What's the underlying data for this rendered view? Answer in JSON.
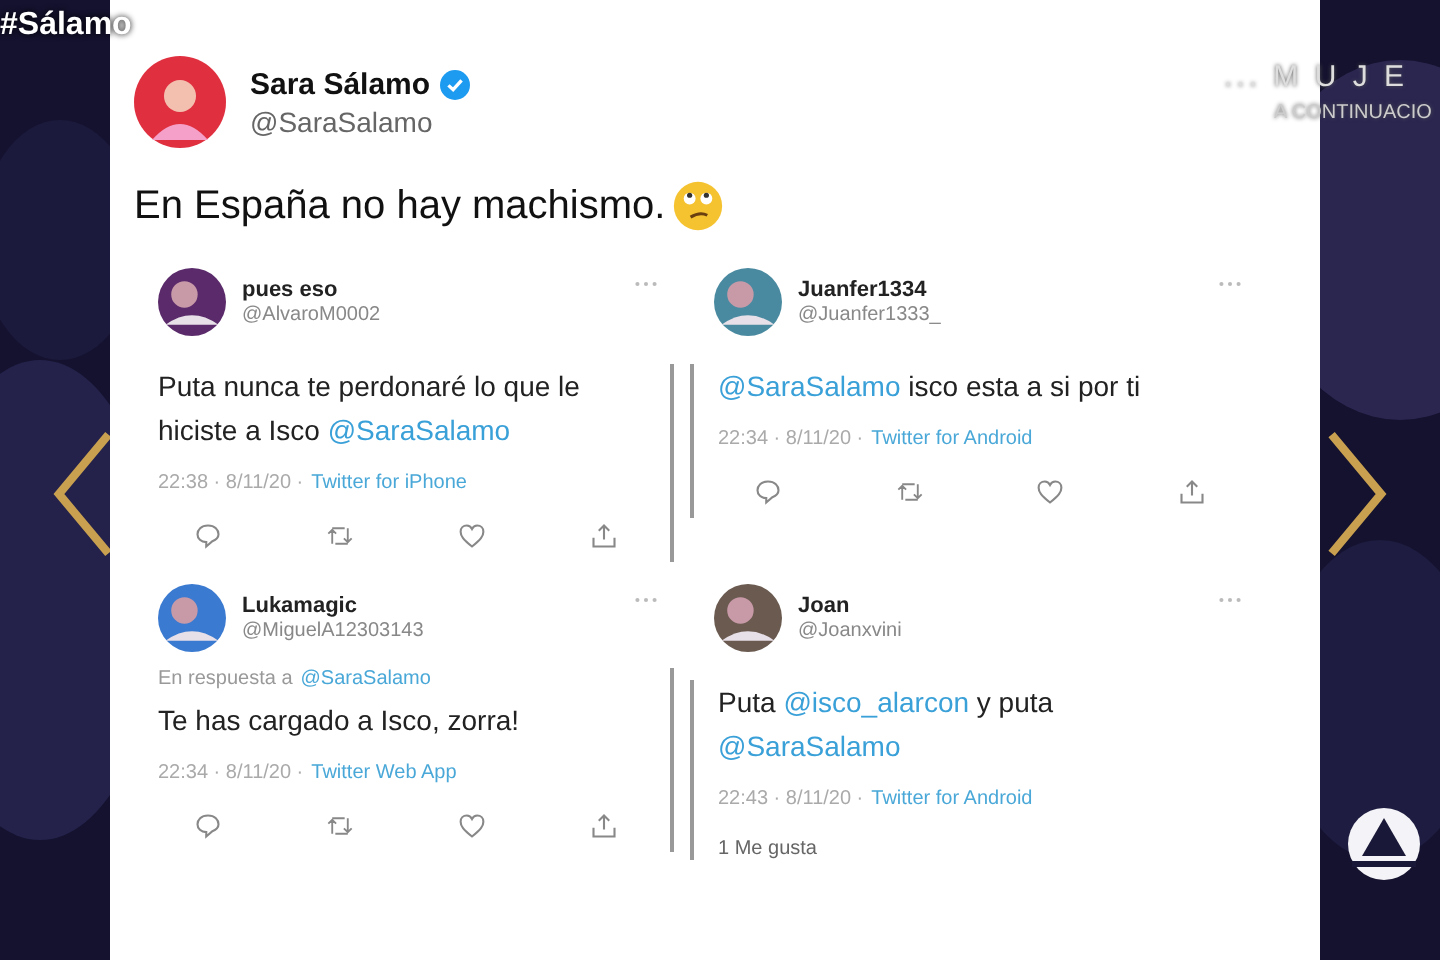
{
  "overlay": {
    "hashtag": "#Sálamo",
    "promo_title": "... M U J E",
    "promo_subtitle": "A CONTINUACIO"
  },
  "tweet": {
    "name": "Sara Sálamo",
    "verified": true,
    "handle": "@SaraSalamo",
    "text": "En España no hay machismo."
  },
  "quoted": [
    {
      "name": "pues eso",
      "handle": "@AlvaroM0002",
      "body": [
        {
          "kind": "text",
          "text": "Puta nunca te perdonaré lo que le hiciste a Isco "
        },
        {
          "kind": "mention",
          "text": "@SaraSalamo"
        }
      ],
      "time": "22:38 · 8/11/20 ·",
      "source": "Twitter for iPhone",
      "footer": {
        "kind": "actions"
      }
    },
    {
      "name": "Juanfer1334",
      "handle": "@Juanfer1333_",
      "body": [
        {
          "kind": "mention",
          "text": "@SaraSalamo"
        },
        {
          "kind": "text",
          "text": " isco esta a si por ti"
        }
      ],
      "time": "22:34 · 8/11/20 ·",
      "source": "Twitter for Android",
      "footer": {
        "kind": "actions"
      }
    },
    {
      "name": "Lukamagic",
      "handle": "@MiguelA12303143",
      "reply_label": "En respuesta a",
      "reply_to": "@SaraSalamo",
      "body": [
        {
          "kind": "text",
          "text": "Te has cargado a Isco, zorra!"
        }
      ],
      "time": "22:34 · 8/11/20 ·",
      "source": "Twitter Web App",
      "footer": {
        "kind": "actions"
      }
    },
    {
      "name": "Joan",
      "handle": "@Joanxvini",
      "body": [
        {
          "kind": "text",
          "text": "Puta "
        },
        {
          "kind": "mention",
          "text": "@isco_alarcon"
        },
        {
          "kind": "text",
          "text": "  y puta "
        },
        {
          "kind": "mention",
          "text": "@SaraSalamo"
        }
      ],
      "time": "22:43 · 8/11/20 ·",
      "source": "Twitter for Android",
      "footer": {
        "kind": "likes",
        "text": "1 Me gusta"
      }
    }
  ]
}
